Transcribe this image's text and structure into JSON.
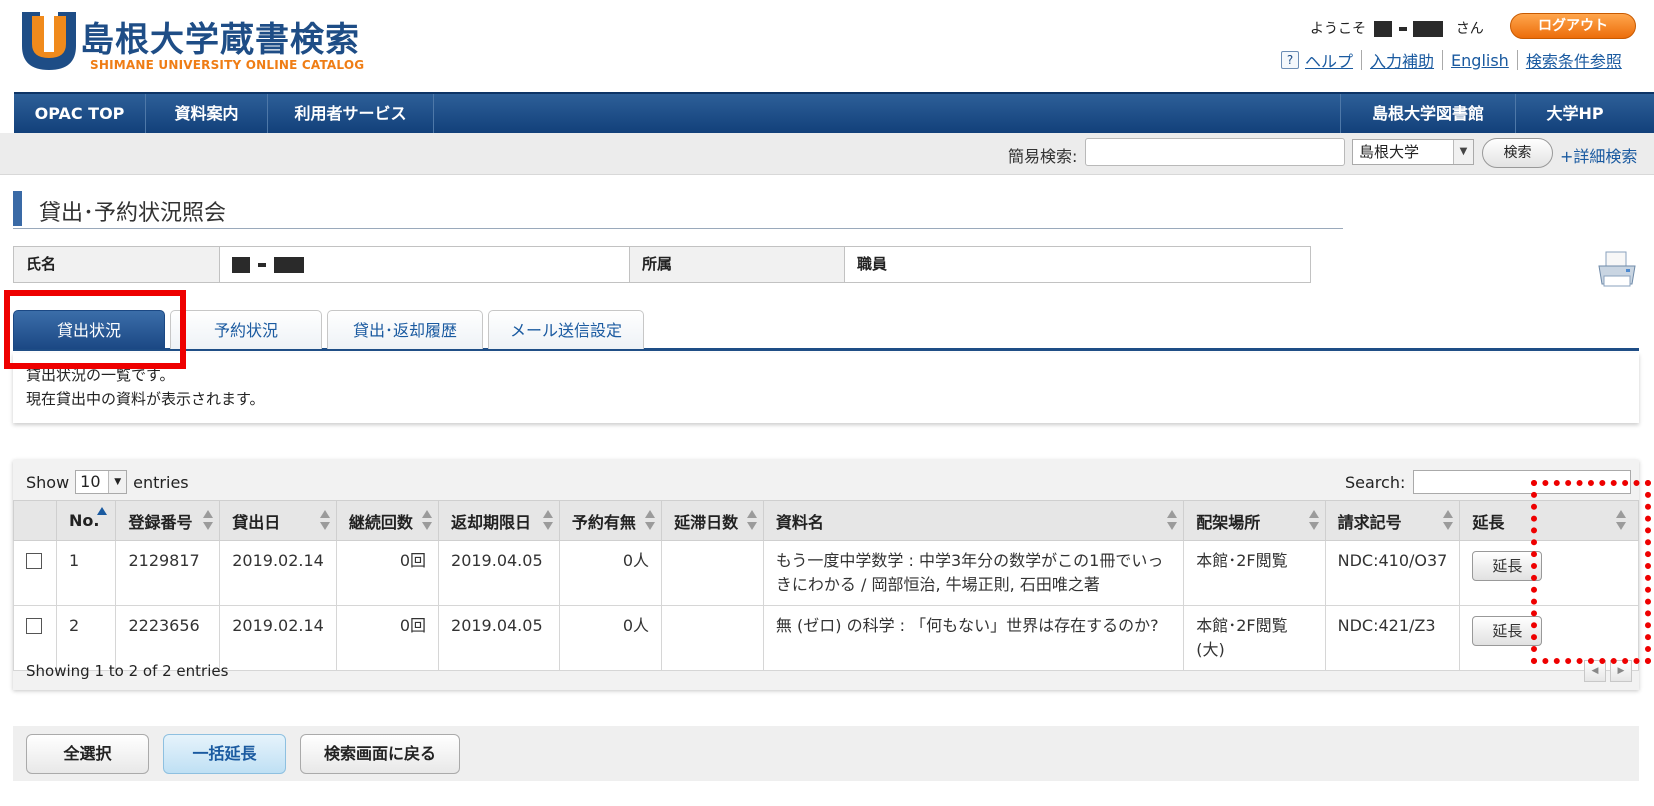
{
  "header": {
    "logo_title": "島根大学蔵書検索",
    "logo_subtitle": "SHIMANE UNIVERSITY ONLINE CATALOG",
    "welcome_prefix": "ようこそ",
    "welcome_suffix": "さん",
    "logout_label": "ログアウト",
    "links": [
      "ヘルプ",
      "入力補助",
      "English",
      "検索条件参照"
    ],
    "help_icon": "?"
  },
  "nav": {
    "left": [
      "OPAC TOP",
      "資料案内",
      "利用者サービス"
    ],
    "right": [
      "島根大学図書館",
      "大学HP"
    ]
  },
  "searchbar": {
    "label": "簡易検索:",
    "input_value": "",
    "scope": "島根大学",
    "button": "検索",
    "advanced": "+詳細検索"
  },
  "page_title": "貸出･予約状況照会",
  "userinfo": {
    "name_label": "氏名",
    "dept_label": "所属",
    "dept_value": "職員"
  },
  "tabs": [
    "貸出状況",
    "予約状況",
    "貸出･返却履歴",
    "メール送信設定"
  ],
  "description": {
    "line1": "貸出状況の一覧です。",
    "line2": "現在貸出中の資料が表示されます。"
  },
  "table": {
    "show_prefix": "Show",
    "length": "10",
    "show_suffix": "entries",
    "search_label": "Search:",
    "columns": [
      "",
      "No.",
      "登録番号",
      "貸出日",
      "継続回数",
      "返却期限日",
      "予約有無",
      "延滞日数",
      "資料名",
      "配架場所",
      "請求記号",
      "延長"
    ],
    "rows": [
      {
        "no": "1",
        "reg": "2129817",
        "loan_date": "2019.02.14",
        "renewals": "0回",
        "due": "2019.04.05",
        "holds": "0人",
        "overdue": "",
        "title": "もう一度中学数学 : 中学3年分の数学がこの1冊でいっきにわかる / 岡部恒治, 牛場正則, 石田唯之著",
        "location": "本館･2F閲覧",
        "call_no": "NDC:410/O37",
        "extend": "延長"
      },
      {
        "no": "2",
        "reg": "2223656",
        "loan_date": "2019.02.14",
        "renewals": "0回",
        "due": "2019.04.05",
        "holds": "0人",
        "overdue": "",
        "title": "無 (ゼロ) の科学 : 「何もない」世界は存在するのか?",
        "location": "本館･2F閲覧(大)",
        "call_no": "NDC:421/Z3",
        "extend": "延長"
      }
    ],
    "info": "Showing 1 to 2 of 2 entries"
  },
  "bottom": {
    "select_all": "全選択",
    "bulk_extend": "一括延長",
    "back": "検索画面に戻る"
  },
  "colors": {
    "nav_blue": "#1e4d86",
    "logout_orange": "#ec6d0a",
    "highlight_red": "#ee0000"
  }
}
